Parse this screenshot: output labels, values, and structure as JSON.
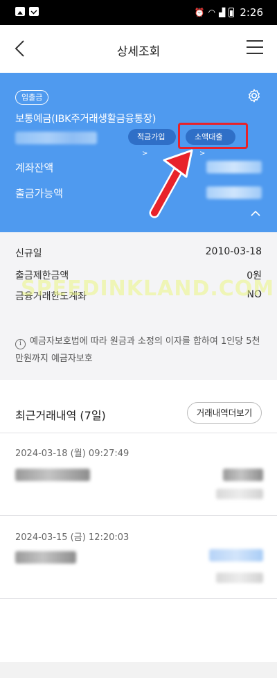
{
  "status_bar": {
    "time": "2:26"
  },
  "header": {
    "title": "상세조회"
  },
  "account": {
    "badge": "입출금",
    "name": "보통예금(IBK주거래생활금융통장)",
    "chip_savings": "적금가입",
    "chip_loan": "소액대출",
    "balance_label": "계좌잔액",
    "withdrawable_label": "출금가능액"
  },
  "details": {
    "rows": [
      {
        "label": "신규일",
        "value": "2010-03-18"
      },
      {
        "label": "출금제한금액",
        "value": "0원"
      },
      {
        "label": "금융거래한도계좌",
        "value": "NO"
      }
    ],
    "watermark": "SPEEDINKLAND.COM",
    "notice": "예금자보호법에 따라 원금과 소정의 이자를 합하여 1인당 5천만원까지 예금자보호"
  },
  "recent": {
    "title": "최근거래내역 (7일)",
    "more_label": "거래내역더보기",
    "transactions": [
      {
        "date": "2024-03-18 (월) 09:27:49"
      },
      {
        "date": "2024-03-15 (금) 12:20:03"
      }
    ]
  },
  "colors": {
    "accent": "#4f9aef",
    "chip": "#2f6fc7",
    "highlight": "#e8222a"
  },
  "icons": [
    "back-arrow-icon",
    "menu-icon",
    "gear-icon",
    "chevron-up-icon",
    "info-icon",
    "chevron-right-icon"
  ]
}
